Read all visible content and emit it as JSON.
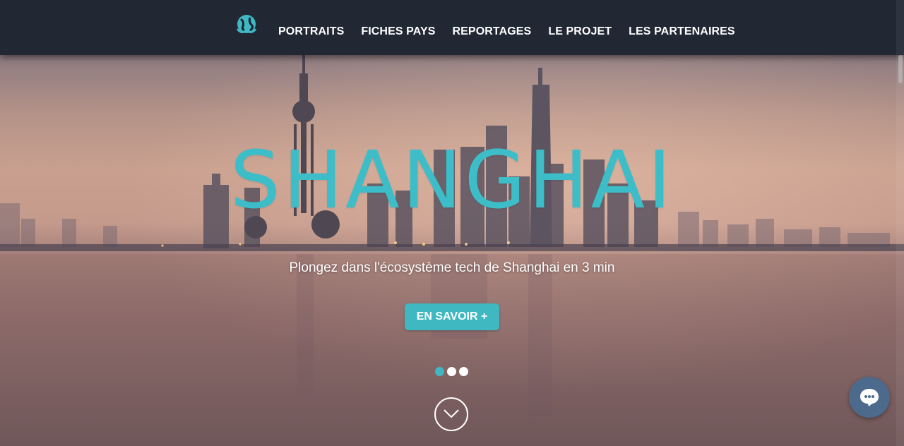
{
  "nav": {
    "logo_icon": "globe-hands-icon",
    "items": [
      {
        "label": "PORTRAITS"
      },
      {
        "label": "FICHES PAYS"
      },
      {
        "label": "REPORTAGES"
      },
      {
        "label": "LE PROJET"
      },
      {
        "label": "LES PARTENAIRES"
      }
    ]
  },
  "hero": {
    "title": "SHANGHAI",
    "subtitle": "Plongez dans l'écosystème tech de Shanghai en 3 min",
    "cta_label": "EN SAVOIR +",
    "slides_total": 3,
    "slide_active": 1,
    "scroll_icon": "chevron-down-icon"
  },
  "chat": {
    "icon": "chat-bubble-icon"
  },
  "colors": {
    "accent": "#3fb8c2",
    "navbar": "#212833",
    "chat": "#4c6a8c"
  }
}
